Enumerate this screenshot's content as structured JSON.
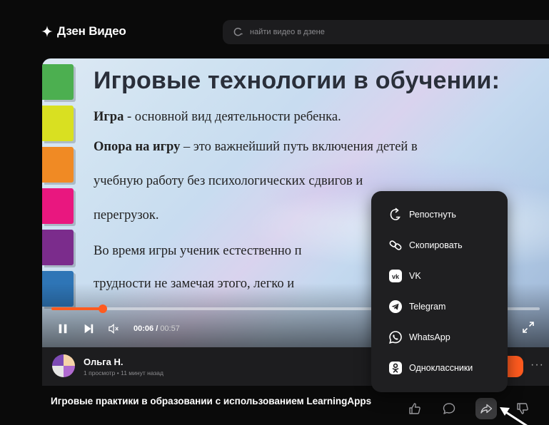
{
  "header": {
    "logo_text": "Дзен Видео",
    "search_placeholder": "найти видео в дзене"
  },
  "slide": {
    "title": "Игровые технологии в обучении:",
    "lines": [
      {
        "bold": "Игра",
        "text": " - основной вид деятельности ребенка."
      },
      {
        "bold": "Опора на игру",
        "text": " – это важнейший путь включения детей в"
      },
      {
        "bold": "",
        "text": "учебную работу без психологических сдвигов и"
      },
      {
        "bold": "",
        "text": "перегрузок."
      },
      {
        "bold": "",
        "text": "Во время игры ученик естественно п"
      },
      {
        "bold": "",
        "text": "трудности не замечая этого, легко и"
      }
    ],
    "tab_colors": [
      "#4caf50",
      "#d9e021",
      "#f08a24",
      "#e9177f",
      "#7b2c8c",
      "#2e75b6"
    ]
  },
  "player": {
    "current_time": "00:06",
    "duration": "00:57",
    "progress_fraction": 0.105
  },
  "author": {
    "name": "Ольга Н.",
    "meta": "1 просмотр • 11 минут назад"
  },
  "video": {
    "title": "Игровые практики в образовании с использованием LearningApps"
  },
  "share_menu": {
    "items": [
      {
        "label": "Репостнуть",
        "icon": "repost-icon"
      },
      {
        "label": "Скопировать",
        "icon": "link-icon"
      },
      {
        "label": "VK",
        "icon": "vk-icon"
      },
      {
        "label": "Telegram",
        "icon": "telegram-icon"
      },
      {
        "label": "WhatsApp",
        "icon": "whatsapp-icon"
      },
      {
        "label": "Одноклассники",
        "icon": "odnoklassniki-icon"
      }
    ]
  },
  "colors": {
    "accent": "#ff5b1f",
    "background": "#0a0a0a",
    "menu_bg": "#1f1f21"
  }
}
